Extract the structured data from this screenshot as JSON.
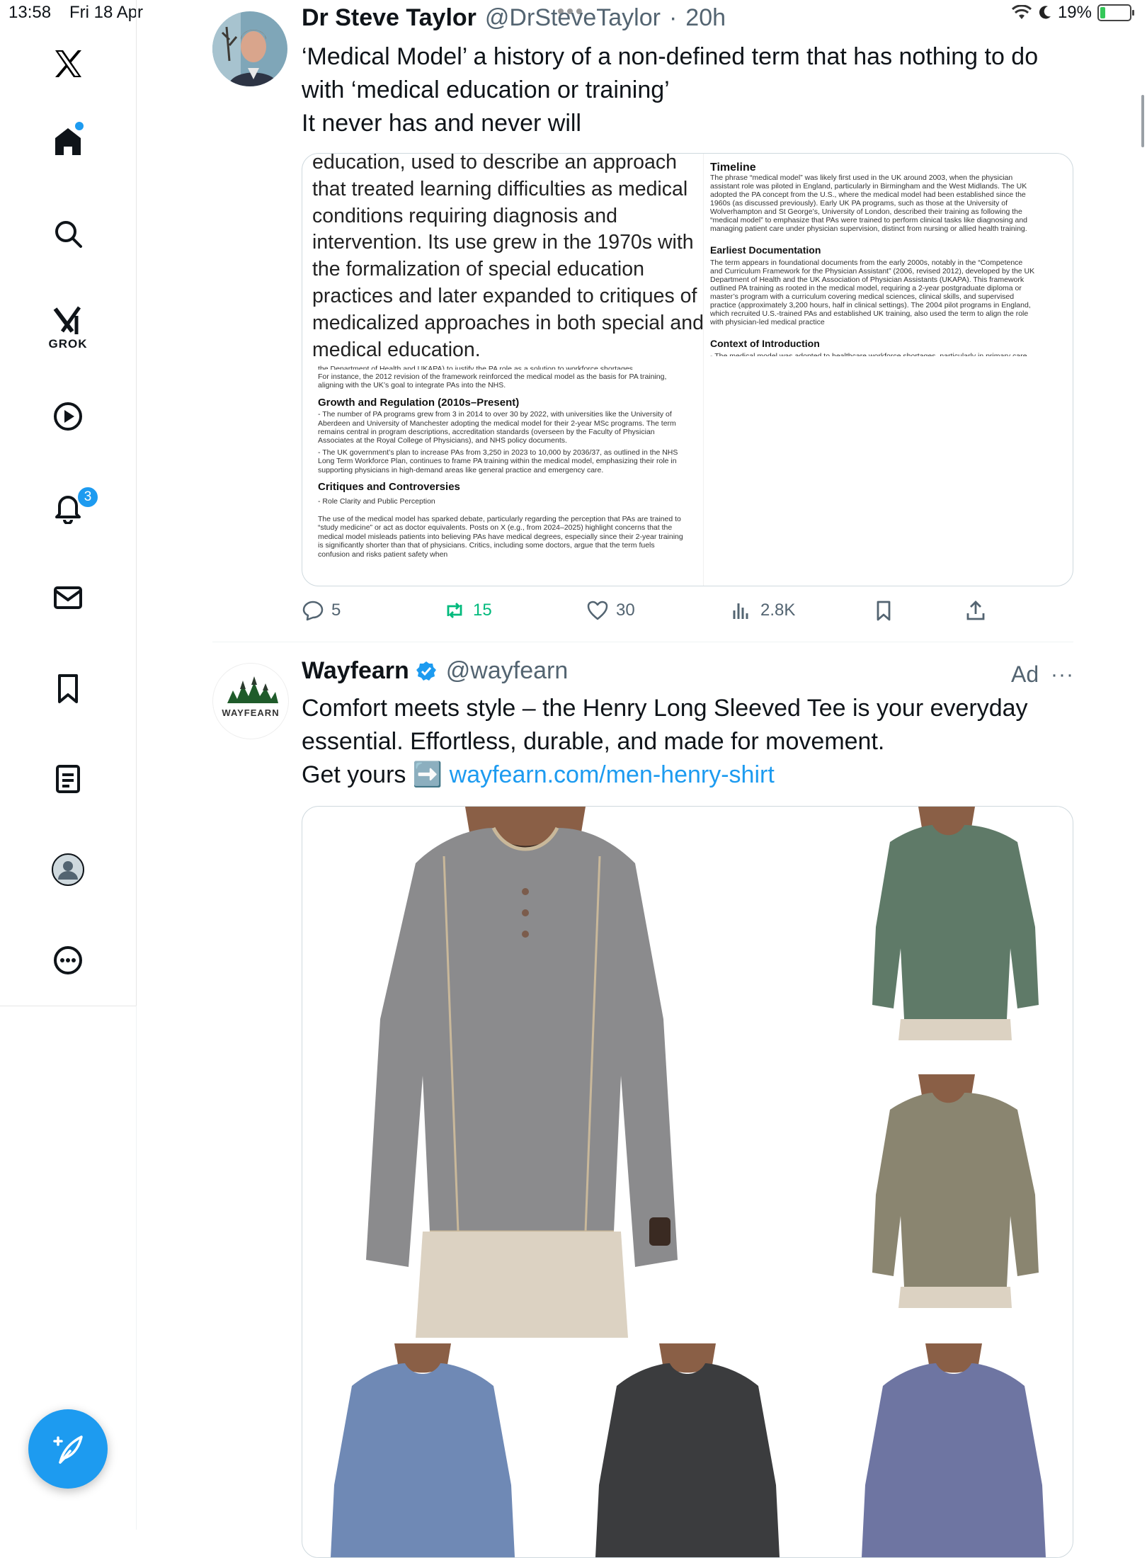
{
  "status_bar": {
    "time": "13:58",
    "date": "Fri 18 Apr",
    "battery": "19%",
    "battery_level": 0.19
  },
  "sidebar": {
    "items": [
      {
        "name": "logo",
        "icon": "x-logo-icon"
      },
      {
        "name": "home",
        "icon": "home-icon",
        "has_dot": true
      },
      {
        "name": "search",
        "icon": "search-icon"
      },
      {
        "name": "grok",
        "icon": "grok-icon",
        "label": "GROK"
      },
      {
        "name": "videos",
        "icon": "play-icon"
      },
      {
        "name": "notifications",
        "icon": "bell-icon",
        "badge": "3"
      },
      {
        "name": "messages",
        "icon": "mail-icon"
      },
      {
        "name": "bookmarks",
        "icon": "bookmark-icon"
      },
      {
        "name": "lists",
        "icon": "list-icon"
      },
      {
        "name": "profile",
        "icon": "profile-avatar-icon"
      },
      {
        "name": "more",
        "icon": "more-circle-icon"
      }
    ],
    "compose_icon": "compose-feather-icon"
  },
  "post1": {
    "author": "Dr Steve Taylor",
    "handle": "@DrSteveTaylor",
    "separator": "·",
    "time": "20h",
    "lines": [
      "‘Medical Model’ a history of a non-defined term that has nothing to do",
      "with ‘medical education or training’",
      "It never has and never will"
    ],
    "doc_big_text": "education, used to describe an approach that treated learning difficulties as medical conditions requiring diagnosis and intervention. Its use grew in the 1970s with the formalization of special education practices and later expanded to critiques of medicalized approaches in both special and medical education.",
    "doc_small": {
      "cut_line": "the Department of Health and UKAPA) to justify the PA role as a solution to workforce shortages.",
      "intro": "For instance, the 2012 revision of the framework reinforced the medical model as the basis for PA training, aligning with the UK’s goal to integrate PAs into the NHS.",
      "h1": "Growth and Regulation (2010s–Present)",
      "p1": "- The number of PA programs grew from 3 in 2014 to over 30 by 2022, with universities like the University of Aberdeen and University of Manchester adopting the medical model for their 2-year MSc programs. The term remains central in program descriptions, accreditation standards (overseen by the Faculty of Physician Associates at the Royal College of Physicians), and NHS policy documents.",
      "p2": "- The UK government’s plan to increase PAs from 3,250 in 2023 to 10,000 by 2036/37, as outlined in the NHS Long Term Workforce Plan, continues to frame PA training within the medical model, emphasizing their role in supporting physicians in high-demand areas like general practice and emergency care.",
      "h2": "Critiques and Controversies",
      "p3": "- Role Clarity and Public Perception",
      "p4": "The use of the medical model has sparked debate, particularly regarding the perception that PAs are trained to “study medicine” or act as doctor equivalents. Posts on X (e.g., from 2024–2025) highlight concerns that the medical model misleads patients into believing PAs have medical degrees, especially since their 2-year training is significantly shorter than that of physicians. Critics, including some doctors, argue that the term fuels confusion and risks patient safety when"
    },
    "doc_right": {
      "h1": "Timeline",
      "p1": "The phrase “medical model” was likely first used in the UK around 2003, when the physician assistant role was piloted in England, particularly in Birmingham and the West Midlands. The UK adopted the PA concept from the U.S., where the medical model had been established since the 1960s (as discussed previously). Early UK PA programs, such as those at the University of Wolverhampton and St George’s, University of London, described their training as following the “medical model” to emphasize that PAs were trained to perform clinical tasks like diagnosing and managing patient care under physician supervision, distinct from nursing or allied health training.",
      "h2": "Earliest Documentation",
      "p2": "The term appears in foundational documents from the early 2000s, notably in the “Competence and Curriculum Framework for the Physician Assistant” (2006, revised 2012), developed by the UK Department of Health and the UK Association of Physician Assistants (UKAPA). This framework outlined PA training as rooted in the medical model, requiring a 2-year postgraduate diploma or master’s program with a curriculum covering medical sciences, clinical skills, and supervised practice (approximately 3,200 hours, half in clinical settings). The 2004 pilot programs in England, which recruited U.S.-trained PAs and established UK training, also used the term to align the role with physician-led medical practice",
      "h3": "Context of Introduction",
      "p3": "- The medical model was adopted to healthcare workforce shortages, particularly in primary care"
    },
    "actions": {
      "replies": "5",
      "reposts": "15",
      "likes": "30",
      "views": "2.8K"
    }
  },
  "post2": {
    "author": "Wayfearn",
    "handle": "@wayfearn",
    "ad_label": "Ad",
    "more": "···",
    "avatar_text": "WAYFEARN",
    "lines": [
      "Comfort meets style – the Henry Long Sleeved Tee is your everyday",
      "essential. Effortless, durable, and made for movement."
    ],
    "line3_prefix": "Get yours ",
    "line3_emoji": "➡️",
    "link": "wayfearn.com/men-henry-shirt",
    "shirt_colors": {
      "main": "#8b8b8d",
      "green": "#5f7a68",
      "olive": "#8a8570",
      "blue": "#6f89b5",
      "black": "#3b3c3e",
      "navy": "#6e75a2"
    }
  },
  "colors": {
    "accent": "#1d9bf0",
    "repost": "#00ba7c",
    "muted": "#536471"
  }
}
